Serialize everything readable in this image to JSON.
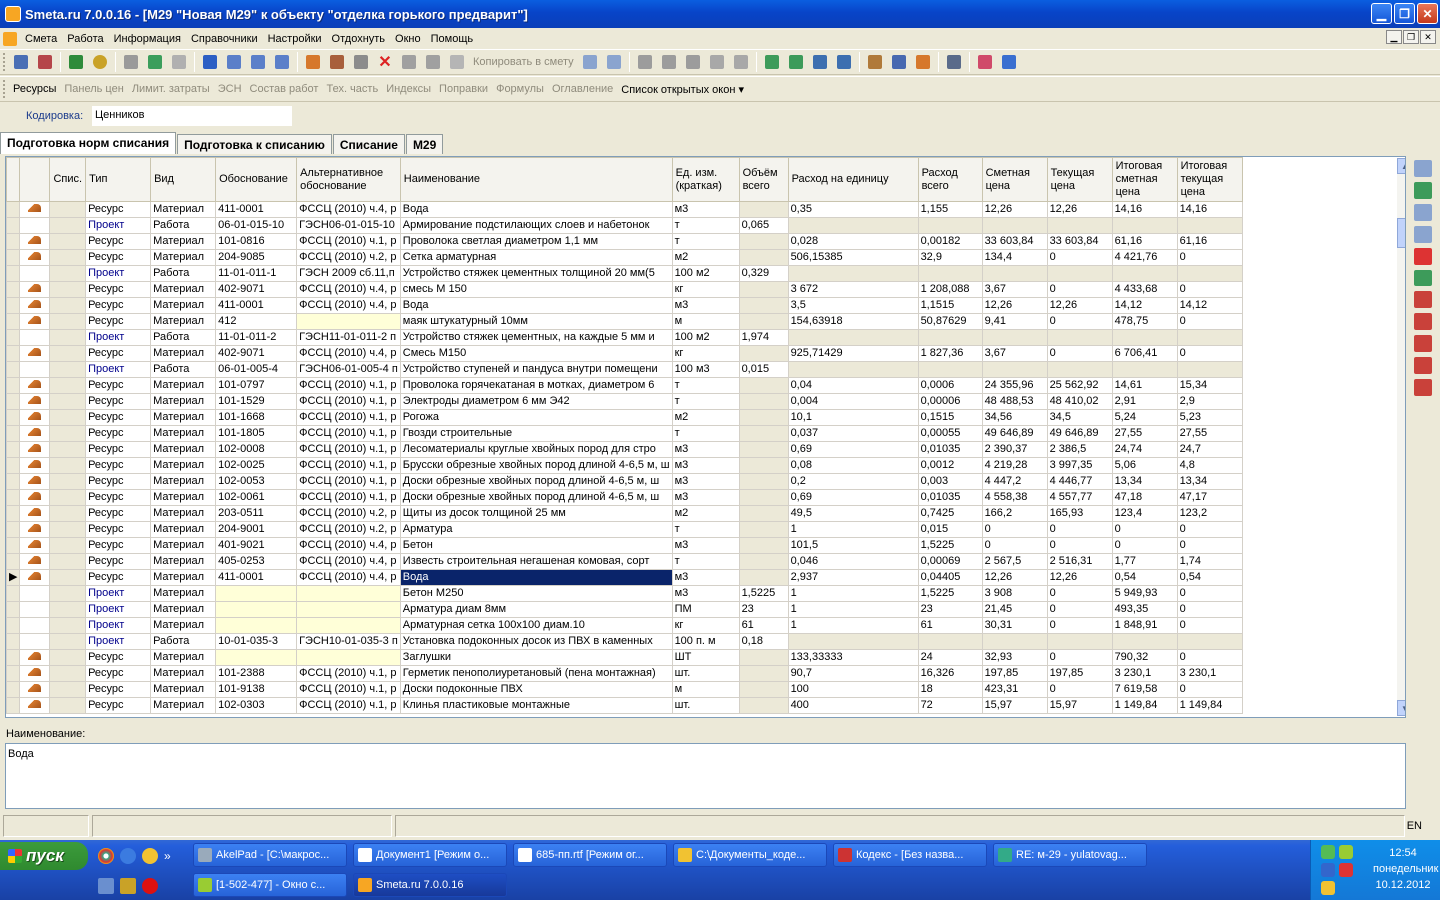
{
  "window": {
    "title": "Smeta.ru  7.0.0.16   - [М29 \"Новая М29\" к объекту \"отделка горького предварит\"]",
    "min": "▁",
    "max": "❐",
    "close": "✕"
  },
  "menu": [
    "Смета",
    "Работа",
    "Информация",
    "Справочники",
    "Настройки",
    "Отдохнуть",
    "Окно",
    "Помощь"
  ],
  "toolbar1": {
    "copy_label": "Копировать в смету"
  },
  "toolbar2": {
    "items": [
      "Ресурсы",
      "Панель цен",
      "Лимит. затраты",
      "ЭСН",
      "Состав работ",
      "Тех. часть",
      "Индексы",
      "Поправки",
      "Формулы",
      "Оглавление"
    ],
    "open_windows": "Список открытых окон ▾"
  },
  "coding": {
    "label": "Кодировка:",
    "value": "Ценников"
  },
  "tabs": [
    "Подготовка норм списания",
    "Подготовка к списанию",
    "Списание",
    "М29"
  ],
  "grid": {
    "headers": [
      "",
      "",
      "Спис.",
      "Тип",
      "Вид",
      "Обоснование",
      "Альтернативное обоснование",
      "Наименование",
      "Ед. изм. (краткая)",
      "Объём всего",
      "Расход на единицу",
      "Расход всего",
      "Сметная цена",
      "Текущая цена",
      "Итоговая сметная цена",
      "Итоговая текущая цена"
    ],
    "rows": [
      [
        "",
        "r",
        "",
        "Ресурс",
        "Материал",
        "411-0001",
        "ФССЦ (2010) ч.4, р",
        "Вода",
        "м3",
        "",
        "0,35",
        "1,155",
        "12,26",
        "12,26",
        "14,16",
        "14,16"
      ],
      [
        "",
        "",
        "",
        "Проект",
        "Работа",
        "06-01-015-10",
        "ГЭСН06-01-015-10",
        "Армирование подстилающих слоев и набетонок",
        "т",
        "0,065",
        "",
        "",
        "",
        "",
        "",
        ""
      ],
      [
        "",
        "r",
        "",
        "Ресурс",
        "Материал",
        "101-0816",
        "ФССЦ (2010) ч.1, р",
        "Проволока светлая диаметром 1,1 мм",
        "т",
        "",
        "0,028",
        "0,00182",
        "33 603,84",
        "33 603,84",
        "61,16",
        "61,16"
      ],
      [
        "",
        "r",
        "",
        "Ресурс",
        "Материал",
        "204-9085",
        "ФССЦ (2010) ч.2, р",
        "Сетка арматурная",
        "м2",
        "",
        "506,15385",
        "32,9",
        "134,4",
        "0",
        "4 421,76",
        "0"
      ],
      [
        "",
        "",
        "",
        "Проект",
        "Работа",
        "11-01-011-1",
        "ГЭСН 2009 сб.11,п",
        "Устройство стяжек цементных толщиной 20 мм(5",
        "100 м2",
        "0,329",
        "",
        "",
        "",
        "",
        "",
        ""
      ],
      [
        "",
        "r",
        "",
        "Ресурс",
        "Материал",
        "402-9071",
        "ФССЦ (2010) ч.4, р",
        "смесь М 150",
        "кг",
        "",
        "3 672",
        "1 208,088",
        "3,67",
        "0",
        "4 433,68",
        "0"
      ],
      [
        "",
        "r",
        "",
        "Ресурс",
        "Материал",
        "411-0001",
        "ФССЦ (2010) ч.4, р",
        "Вода",
        "м3",
        "",
        "3,5",
        "1,1515",
        "12,26",
        "12,26",
        "14,12",
        "14,12"
      ],
      [
        "",
        "r",
        "",
        "Ресурс",
        "Материал",
        "412",
        "",
        "маяк штукатурный 10мм",
        "м",
        "",
        "154,63918",
        "50,87629",
        "9,41",
        "0",
        "478,75",
        "0"
      ],
      [
        "",
        "",
        "",
        "Проект",
        "Работа",
        "11-01-011-2",
        "ГЭСН11-01-011-2 п",
        "Устройство стяжек цементных, на каждые 5 мм и",
        "100 м2",
        "1,974",
        "",
        "",
        "",
        "",
        "",
        ""
      ],
      [
        "",
        "r",
        "",
        "Ресурс",
        "Материал",
        "402-9071",
        "ФССЦ (2010) ч.4, р",
        "Смесь М150",
        "кг",
        "",
        "925,71429",
        "1 827,36",
        "3,67",
        "0",
        "6 706,41",
        "0"
      ],
      [
        "",
        "",
        "",
        "Проект",
        "Работа",
        "06-01-005-4",
        "ГЭСН06-01-005-4 п",
        "Устройство ступеней и пандуса внутри помещени",
        "100 м3",
        "0,015",
        "",
        "",
        "",
        "",
        "",
        ""
      ],
      [
        "",
        "r",
        "",
        "Ресурс",
        "Материал",
        "101-0797",
        "ФССЦ (2010) ч.1, р",
        "Проволока горячекатаная в мотках, диаметром 6",
        "т",
        "",
        "0,04",
        "0,0006",
        "24 355,96",
        "25 562,92",
        "14,61",
        "15,34"
      ],
      [
        "",
        "r",
        "",
        "Ресурс",
        "Материал",
        "101-1529",
        "ФССЦ (2010) ч.1, р",
        "Электроды диаметром 6 мм Э42",
        "т",
        "",
        "0,004",
        "0,00006",
        "48 488,53",
        "48 410,02",
        "2,91",
        "2,9"
      ],
      [
        "",
        "r",
        "",
        "Ресурс",
        "Материал",
        "101-1668",
        "ФССЦ (2010) ч.1, р",
        "Рогожа",
        "м2",
        "",
        "10,1",
        "0,1515",
        "34,56",
        "34,5",
        "5,24",
        "5,23"
      ],
      [
        "",
        "r",
        "",
        "Ресурс",
        "Материал",
        "101-1805",
        "ФССЦ (2010) ч.1, р",
        "Гвозди строительные",
        "т",
        "",
        "0,037",
        "0,00055",
        "49 646,89",
        "49 646,89",
        "27,55",
        "27,55"
      ],
      [
        "",
        "r",
        "",
        "Ресурс",
        "Материал",
        "102-0008",
        "ФССЦ (2010) ч.1, р",
        "Лесоматериалы круглые хвойных пород для стро",
        "м3",
        "",
        "0,69",
        "0,01035",
        "2 390,37",
        "2 386,5",
        "24,74",
        "24,7"
      ],
      [
        "",
        "r",
        "",
        "Ресурс",
        "Материал",
        "102-0025",
        "ФССЦ (2010) ч.1, р",
        "Брусски обрезные хвойных пород длиной 4-6,5 м, ш",
        "м3",
        "",
        "0,08",
        "0,0012",
        "4 219,28",
        "3 997,35",
        "5,06",
        "4,8"
      ],
      [
        "",
        "r",
        "",
        "Ресурс",
        "Материал",
        "102-0053",
        "ФССЦ (2010) ч.1, р",
        "Доски обрезные хвойных пород длиной 4-6,5 м, ш",
        "м3",
        "",
        "0,2",
        "0,003",
        "4 447,2",
        "4 446,77",
        "13,34",
        "13,34"
      ],
      [
        "",
        "r",
        "",
        "Ресурс",
        "Материал",
        "102-0061",
        "ФССЦ (2010) ч.1, р",
        "Доски обрезные хвойных пород длиной 4-6,5 м, ш",
        "м3",
        "",
        "0,69",
        "0,01035",
        "4 558,38",
        "4 557,77",
        "47,18",
        "47,17"
      ],
      [
        "",
        "r",
        "",
        "Ресурс",
        "Материал",
        "203-0511",
        "ФССЦ (2010) ч.2, р",
        "Щиты из досок толщиной 25 мм",
        "м2",
        "",
        "49,5",
        "0,7425",
        "166,2",
        "165,93",
        "123,4",
        "123,2"
      ],
      [
        "",
        "r",
        "",
        "Ресурс",
        "Материал",
        "204-9001",
        "ФССЦ (2010) ч.2, р",
        "Арматура",
        "т",
        "",
        "1",
        "0,015",
        "0",
        "0",
        "0",
        "0"
      ],
      [
        "",
        "r",
        "",
        "Ресурс",
        "Материал",
        "401-9021",
        "ФССЦ (2010) ч.4, р",
        "Бетон",
        "м3",
        "",
        "101,5",
        "1,5225",
        "0",
        "0",
        "0",
        "0"
      ],
      [
        "",
        "r",
        "",
        "Ресурс",
        "Материал",
        "405-0253",
        "ФССЦ (2010) ч.4, р",
        "Известь строительная негашеная комовая, сорт",
        "т",
        "",
        "0,046",
        "0,00069",
        "2 567,5",
        "2 516,31",
        "1,77",
        "1,74"
      ],
      [
        "▶",
        "r",
        "",
        "Ресурс",
        "Материал",
        "411-0001",
        "ФССЦ (2010) ч.4, р",
        "Вода",
        "м3",
        "",
        "2,937",
        "0,04405",
        "12,26",
        "12,26",
        "0,54",
        "0,54"
      ],
      [
        "",
        "",
        "",
        "Проект",
        "Материал",
        "",
        "",
        "Бетон М250",
        "м3",
        "1,5225",
        "1",
        "1,5225",
        "3 908",
        "0",
        "5 949,93",
        "0"
      ],
      [
        "",
        "",
        "",
        "Проект",
        "Материал",
        "",
        "",
        "Арматура диам 8мм",
        "ПМ",
        "23",
        "1",
        "23",
        "21,45",
        "0",
        "493,35",
        "0"
      ],
      [
        "",
        "",
        "",
        "Проект",
        "Материал",
        "",
        "",
        "Арматурная сетка 100х100 диам.10",
        "кг",
        "61",
        "1",
        "61",
        "30,31",
        "0",
        "1 848,91",
        "0"
      ],
      [
        "",
        "",
        "",
        "Проект",
        "Работа",
        "10-01-035-3",
        "ГЭСН10-01-035-3 п",
        "Установка подоконных досок из ПВХ в каменных",
        "100 п. м",
        "0,18",
        "",
        "",
        "",
        "",
        "",
        ""
      ],
      [
        "",
        "r",
        "",
        "Ресурс",
        "Материал",
        "",
        "",
        "Заглушки",
        "ШТ",
        "",
        "133,33333",
        "24",
        "32,93",
        "0",
        "790,32",
        "0"
      ],
      [
        "",
        "r",
        "",
        "Ресурс",
        "Материал",
        "101-2388",
        "ФССЦ (2010) ч.1, р",
        "Герметик пенополиуретановый (пена монтажная)",
        "шт.",
        "",
        "90,7",
        "16,326",
        "197,85",
        "197,85",
        "3 230,1",
        "3 230,1"
      ],
      [
        "",
        "r",
        "",
        "Ресурс",
        "Материал",
        "101-9138",
        "ФССЦ (2010) ч.1, р",
        "Доски подоконные ПВХ",
        "м",
        "",
        "100",
        "18",
        "423,31",
        "0",
        "7 619,58",
        "0"
      ],
      [
        "",
        "r",
        "",
        "Ресурс",
        "Материал",
        "102-0303",
        "ФССЦ (2010) ч.1, р",
        "Клинья пластиковые монтажные",
        "шт.",
        "",
        "400",
        "72",
        "15,97",
        "15,97",
        "1 149,84",
        "1 149,84"
      ]
    ]
  },
  "name_panel": {
    "label": "Наименование:",
    "value": "Вода"
  },
  "status": {
    "lang": "EN"
  },
  "taskbar": {
    "start": "пуск",
    "tasks": [
      "AkelPad - [C:\\макрос...",
      "Документ1 [Режим о...",
      "685-пп.rtf [Режим ог...",
      "C:\\Документы_коде...",
      "Кодекс - [Без назва...",
      "RE: м-29 - yulatovag...",
      "[1-502-477] - Окно с...",
      "Smeta.ru  7.0.0.16"
    ],
    "quick": "»"
  },
  "clock": {
    "time": "12:54",
    "day": "понедельник",
    "date": "10.12.2012"
  },
  "colors": {
    "title": "#0a4ed0",
    "selected_row": "#0a246a",
    "project_text": "#00008b",
    "yellow": "#ffffd8"
  }
}
